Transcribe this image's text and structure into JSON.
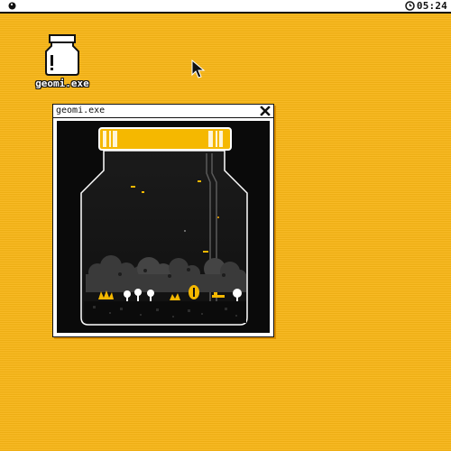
{
  "menubar": {
    "logo_icon": "circle-logo-icon",
    "clock_icon": "clock-icon",
    "time": "05:24"
  },
  "desktop": {
    "icons": [
      {
        "label": "geomi.exe",
        "icon": "jar-icon"
      }
    ]
  },
  "window": {
    "title": "geomi.exe",
    "close_icon": "close-x-icon"
  },
  "colors": {
    "desktop": "#f7b515",
    "ink": "#111111",
    "lid_gold": "#f5b800",
    "jar_interior": "#141414"
  }
}
